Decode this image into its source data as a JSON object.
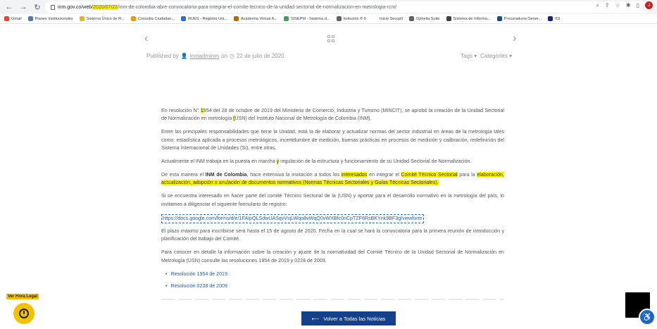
{
  "browser": {
    "url_prefix": "inm.gov.co/web/",
    "url_highlight": "2020/07/22",
    "url_suffix": "/inm-de-colombia-abre-convocatoria-para-integrar-el-comite-tecnico-de-la-unidad-sectorial-de-normalizacion-en-metrologia-rcm/",
    "profile_initial": "J",
    "back_icon": "arrow-left",
    "forward_icon": "arrow-right",
    "reload_icon": "reload",
    "home_icon": "home"
  },
  "bookmarks": [
    {
      "label": "Gmail",
      "color": "#ea4335"
    },
    {
      "label": "Planes Institucionales",
      "color": "#4a7ab8"
    },
    {
      "label": "Sistema Único de R...",
      "color": "#f4b400"
    },
    {
      "label": "Consulta Ciudadan...",
      "color": "#f29900"
    },
    {
      "label": "RUES - Registro Uni...",
      "color": "#1a73e8"
    },
    {
      "label": "Academia Virtual A...",
      "color": "#b36b00"
    },
    {
      "label": "SISEPM - Sistema d...",
      "color": "#34a853"
    },
    {
      "label": "Isolución ® 5",
      "color": "#5f6368"
    },
    {
      "label": "Inicio Secopll",
      "color": "#ffffff"
    },
    {
      "label": "Ophelia Suite",
      "color": "#5f6368"
    },
    {
      "label": "Sistema de Informa...",
      "color": "#3c4043"
    },
    {
      "label": "Procuraduria Gener...",
      "color": "#1a4b8c"
    },
    {
      "label": "IDI",
      "color": "#1a237e"
    }
  ],
  "post_meta": {
    "published_by": "Published by",
    "author": "inmadminm",
    "on": "on",
    "date": "22 de julio de 2020",
    "tags": "Tags",
    "categories": "Categories"
  },
  "article": {
    "p1_a": "En resolución N° ",
    "p1_hl1": "1",
    "p1_b": "954 del 28 de octubre de 2019 del Ministerio de Comercio, Industria y Turismo (MINCIT), se aprobó la creación de la Unidad Sectorial de Normalización en metrología ",
    "p1_hl2": "(",
    "p1_c": "USN) del Instituto Nacional de Metrología de Colombia (INM).",
    "p2": "Entre las principales responsabilidades que tiene la Unidad, está la de elaborar y actualizar normas del sector industrial en áreas de la metrología tales como: estadística aplicada a procesos metrológicos, incertidumbre de medición, buenas prácticas en procesos de medición y calibración, redefinición del Sistema Internacional de Unidades (SI), entre otras.",
    "p3_a": "Actualmente el INM trabaja en la puesta en marcha ",
    "p3_hl": "y",
    "p3_b": " regulación de la estructura y funcionamiento de su Unidad Sectorial de Normalización.",
    "p4_a": "De esta manera el ",
    "p4_bold": "INM de Colombia",
    "p4_b": ", hace extensiva la invitación a todos los ",
    "p4_hl1": "interesados",
    "p4_c": " en integrar el ",
    "p4_hl2": "Comité Técnico Sectorial",
    "p4_d": " para la ",
    "p4_hl3": "elaboración, actualización, adopción o anulación de documentos normativos (Normas Técnicas Sectoriales y Guías Técnicas Sectoriales).",
    "p5": "Si se encuentra interesado en hacer parte del comité Técnico Sectorial de la (USN) y aportar para el desarrollo normativo en la metrología del país, lo invitamos a diligenciar el siguiente formulario de registro:",
    "form_url": "https://docs.google.com/forms/d/e/1FAIpQLSdwUASqvVsjLWqo8vWqQ0vWXBfc0nCpTZF6RsBKYnk9BF3g/viewform",
    "p6": "El plazo máximo para inscribirse será hasta el 15 de agosto de 2020. Fecha en la cual se hará la convocatoria para la primera reunión de introducción y planificación del trabajo del Comité.",
    "p7": "Para conocer en detalle la información sobre la creación y ajuste de la normatividad del Comité Técnico de la Unidad Sectorial de Normalización en Metrología (USN) consulte las resoluciones 1954 de 2019 y 0228 de 2009.",
    "resolutions": [
      "Resolución 1954 de 2019",
      "Resolución 0228 de 2009"
    ]
  },
  "buttons": {
    "back_to_news": "Volver a Todas las Noticias"
  },
  "widgets": {
    "hora_legal": "Ver Hora Legal"
  },
  "colors": {
    "highlight": "#fff200",
    "primary_button": "#13418b",
    "link": "#2a5aa6",
    "hora_legal": "#f2c200"
  }
}
